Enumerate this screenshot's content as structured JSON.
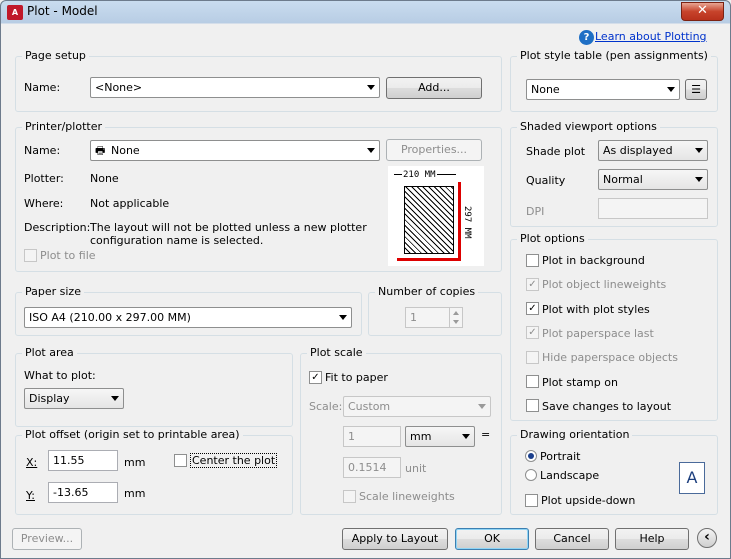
{
  "window": {
    "title": "Plot - Model",
    "icon_text": "A",
    "close_glyph": "✕"
  },
  "help_link": {
    "icon_glyph": "?",
    "label": "Learn about Plotting"
  },
  "page_setup": {
    "title": "Page setup",
    "name_label": "Name:",
    "name_value": "<None>",
    "add_button": "Add..."
  },
  "printer": {
    "title": "Printer/plotter",
    "name_label": "Name:",
    "name_value": "None",
    "properties_button": "Properties...",
    "plotter_label": "Plotter:",
    "plotter_value": "None",
    "where_label": "Where:",
    "where_value": "Not applicable",
    "description_label": "Description:",
    "description_line1": "The layout will not be plotted unless a new plotter",
    "description_line2": "configuration name is selected.",
    "plot_to_file": "Plot to file",
    "preview_width": "210  MM",
    "preview_height": "297  MM"
  },
  "paper_size": {
    "title": "Paper size",
    "value": "ISO A4 (210.00 x 297.00 MM)"
  },
  "copies": {
    "title": "Number of copies",
    "value": "1"
  },
  "plot_area": {
    "title": "Plot area",
    "what_label": "What to plot:",
    "value": "Display"
  },
  "plot_offset": {
    "title": "Plot offset (origin set to printable area)",
    "x_label": "X:",
    "x_value": "11.55",
    "x_unit": "mm",
    "y_label": "Y:",
    "y_value": "-13.65",
    "y_unit": "mm",
    "center": "Center the plot"
  },
  "plot_scale": {
    "title": "Plot scale",
    "fit": "Fit to paper",
    "scale_label": "Scale:",
    "scale_value": "Custom",
    "value1": "1",
    "unit": "mm",
    "equals": "=",
    "value2": "0.1514",
    "unit2": "unit",
    "scale_lw": "Scale lineweights"
  },
  "plot_style_table": {
    "title": "Plot style table (pen assignments)",
    "value": "None"
  },
  "shaded": {
    "title": "Shaded viewport options",
    "shade_label": "Shade plot",
    "shade_value": "As displayed",
    "quality_label": "Quality",
    "quality_value": "Normal",
    "dpi_label": "DPI"
  },
  "plot_options": {
    "title": "Plot options",
    "items": [
      {
        "label": "Plot in background",
        "checked": false,
        "disabled": false
      },
      {
        "label": "Plot object lineweights",
        "checked": true,
        "disabled": true
      },
      {
        "label": "Plot with plot styles",
        "checked": true,
        "disabled": false
      },
      {
        "label": "Plot paperspace last",
        "checked": true,
        "disabled": true
      },
      {
        "label": "Hide paperspace objects",
        "checked": false,
        "disabled": true
      },
      {
        "label": "Plot stamp on",
        "checked": false,
        "disabled": false
      },
      {
        "label": "Save changes to layout",
        "checked": false,
        "disabled": false
      }
    ]
  },
  "orientation": {
    "title": "Drawing orientation",
    "portrait": "Portrait",
    "landscape": "Landscape",
    "upside": "Plot upside-down",
    "icon_letter": "A"
  },
  "buttons": {
    "preview": "Preview...",
    "apply": "Apply to Layout",
    "ok": "OK",
    "cancel": "Cancel",
    "help": "Help",
    "more_glyph": "‹"
  },
  "checkmark": "✓"
}
